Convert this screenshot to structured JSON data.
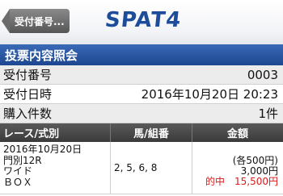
{
  "header": {
    "back_label": "受付番号...",
    "logo_text": "SPAT4"
  },
  "page_title": "投票内容照会",
  "info": {
    "receipt_no_label": "受付番号",
    "receipt_no_value": "0003",
    "receipt_date_label": "受付日時",
    "receipt_date_value": "2016年10月20日 20:23",
    "purchase_count_label": "購入件数",
    "purchase_count_value": "1件"
  },
  "table": {
    "headers": [
      "レース/式別",
      "馬/組番",
      "金額"
    ],
    "rows": [
      {
        "date": "2016年10月20日",
        "race": "門別12R",
        "bet_type": "ワイド",
        "method": "ＢＯＸ",
        "numbers": "2, 5, 6, 8",
        "unit_amount": "(各500円)",
        "total_amount": "3,000円",
        "hit_label": "的中",
        "payout": "15,500円"
      }
    ]
  },
  "colors": {
    "title_bar": "#2856a3",
    "logo": "#1d4d9a",
    "hit": "#d81a1a"
  }
}
